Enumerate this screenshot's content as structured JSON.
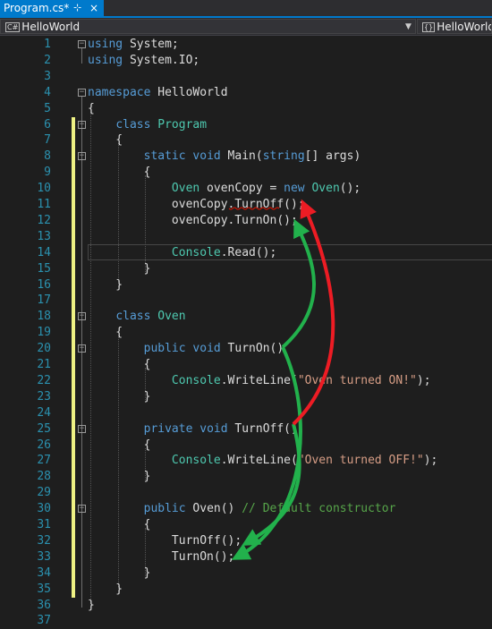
{
  "tab": {
    "title": "Program.cs*",
    "pin": "⊹",
    "close": "×"
  },
  "navbar": {
    "left_label": "HelloWorld",
    "right_label": "HelloWorld."
  },
  "lines": [
    {
      "n": "1",
      "tokens": [
        {
          "t": "using",
          "c": "kw"
        },
        {
          "t": " System;"
        }
      ]
    },
    {
      "n": "2",
      "tokens": [
        {
          "t": "using",
          "c": "kw"
        },
        {
          "t": " System.IO;"
        }
      ]
    },
    {
      "n": "3",
      "tokens": []
    },
    {
      "n": "4",
      "tokens": [
        {
          "t": "namespace",
          "c": "kw"
        },
        {
          "t": " HelloWorld"
        }
      ]
    },
    {
      "n": "5",
      "tokens": [
        {
          "t": "{"
        }
      ]
    },
    {
      "n": "6",
      "tokens": [
        {
          "t": "    "
        },
        {
          "t": "class",
          "c": "kw"
        },
        {
          "t": " "
        },
        {
          "t": "Program",
          "c": "ty"
        }
      ]
    },
    {
      "n": "7",
      "tokens": [
        {
          "t": "    {"
        }
      ]
    },
    {
      "n": "8",
      "tokens": [
        {
          "t": "        "
        },
        {
          "t": "static",
          "c": "kw"
        },
        {
          "t": " "
        },
        {
          "t": "void",
          "c": "kw"
        },
        {
          "t": " Main("
        },
        {
          "t": "string",
          "c": "kw"
        },
        {
          "t": "[] args)"
        }
      ]
    },
    {
      "n": "9",
      "tokens": [
        {
          "t": "        {"
        }
      ]
    },
    {
      "n": "10",
      "tokens": [
        {
          "t": "            "
        },
        {
          "t": "Oven",
          "c": "ty"
        },
        {
          "t": " ovenCopy = "
        },
        {
          "t": "new",
          "c": "kw"
        },
        {
          "t": " "
        },
        {
          "t": "Oven",
          "c": "ty"
        },
        {
          "t": "();"
        }
      ]
    },
    {
      "n": "11",
      "tokens": [
        {
          "t": "            ovenCopy.TurnOff();"
        }
      ]
    },
    {
      "n": "12",
      "tokens": [
        {
          "t": "            ovenCopy.TurnOn();"
        }
      ]
    },
    {
      "n": "13",
      "tokens": []
    },
    {
      "n": "14",
      "tokens": [
        {
          "t": "            "
        },
        {
          "t": "Console",
          "c": "ty"
        },
        {
          "t": ".Read();"
        }
      ]
    },
    {
      "n": "15",
      "tokens": [
        {
          "t": "        }"
        }
      ]
    },
    {
      "n": "16",
      "tokens": [
        {
          "t": "    }"
        }
      ]
    },
    {
      "n": "17",
      "tokens": []
    },
    {
      "n": "18",
      "tokens": [
        {
          "t": "    "
        },
        {
          "t": "class",
          "c": "kw"
        },
        {
          "t": " "
        },
        {
          "t": "Oven",
          "c": "ty"
        }
      ]
    },
    {
      "n": "19",
      "tokens": [
        {
          "t": "    {"
        }
      ]
    },
    {
      "n": "20",
      "tokens": [
        {
          "t": "        "
        },
        {
          "t": "public",
          "c": "kw"
        },
        {
          "t": " "
        },
        {
          "t": "void",
          "c": "kw"
        },
        {
          "t": " TurnOn()"
        }
      ]
    },
    {
      "n": "21",
      "tokens": [
        {
          "t": "        {"
        }
      ]
    },
    {
      "n": "22",
      "tokens": [
        {
          "t": "            "
        },
        {
          "t": "Console",
          "c": "ty"
        },
        {
          "t": ".WriteLine("
        },
        {
          "t": "\"Oven turned ON!\"",
          "c": "str"
        },
        {
          "t": ");"
        }
      ]
    },
    {
      "n": "23",
      "tokens": [
        {
          "t": "        }"
        }
      ]
    },
    {
      "n": "24",
      "tokens": []
    },
    {
      "n": "25",
      "tokens": [
        {
          "t": "        "
        },
        {
          "t": "private",
          "c": "kw"
        },
        {
          "t": " "
        },
        {
          "t": "void",
          "c": "kw"
        },
        {
          "t": " TurnOff()"
        }
      ]
    },
    {
      "n": "26",
      "tokens": [
        {
          "t": "        {"
        }
      ]
    },
    {
      "n": "27",
      "tokens": [
        {
          "t": "            "
        },
        {
          "t": "Console",
          "c": "ty"
        },
        {
          "t": ".WriteLine("
        },
        {
          "t": "\"Oven turned OFF!\"",
          "c": "str"
        },
        {
          "t": ");"
        }
      ]
    },
    {
      "n": "28",
      "tokens": [
        {
          "t": "        }"
        }
      ]
    },
    {
      "n": "29",
      "tokens": []
    },
    {
      "n": "30",
      "tokens": [
        {
          "t": "        "
        },
        {
          "t": "public",
          "c": "kw"
        },
        {
          "t": " Oven() "
        },
        {
          "t": "// Default constructor",
          "c": "cm"
        }
      ]
    },
    {
      "n": "31",
      "tokens": [
        {
          "t": "        {"
        }
      ]
    },
    {
      "n": "32",
      "tokens": [
        {
          "t": "            TurnOff();"
        }
      ]
    },
    {
      "n": "33",
      "tokens": [
        {
          "t": "            TurnOn();"
        }
      ]
    },
    {
      "n": "34",
      "tokens": [
        {
          "t": "        }"
        }
      ]
    },
    {
      "n": "35",
      "tokens": [
        {
          "t": "    }"
        }
      ]
    },
    {
      "n": "36",
      "tokens": [
        {
          "t": "}"
        }
      ]
    },
    {
      "n": "37",
      "tokens": []
    }
  ],
  "colors": {
    "keyword": "#569cd6",
    "type": "#4ec9b0",
    "string": "#d69d85",
    "comment": "#57a64a",
    "line_number": "#2b91af",
    "change_marker": "#eff284",
    "green_arrow": "#22b14c",
    "red_arrow": "#ed1c24"
  }
}
